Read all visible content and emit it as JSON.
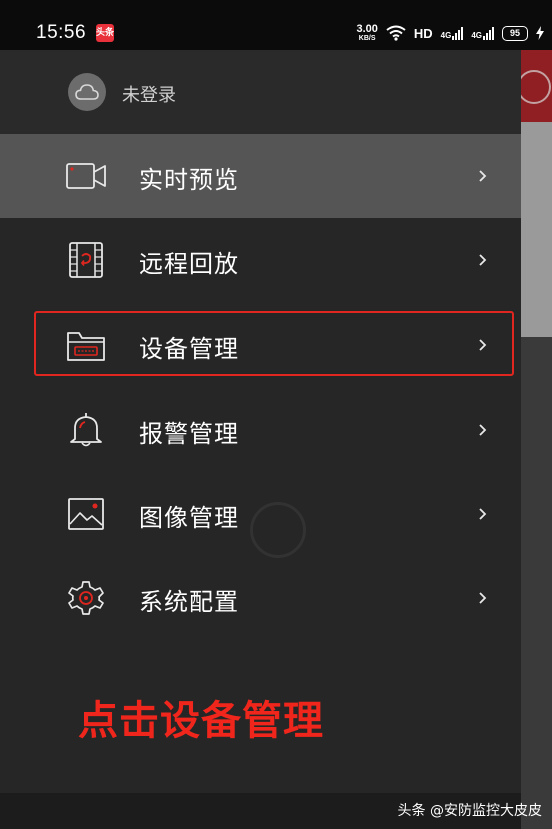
{
  "status_bar": {
    "time": "15:56",
    "app_badge": "头条",
    "net_speed_value": "3.00",
    "net_speed_unit": "KB/S",
    "hd_label": "HD",
    "network_label_1": "4G",
    "network_label_2": "4G",
    "battery": "95"
  },
  "account": {
    "label": "未登录",
    "icon": "cloud-icon"
  },
  "menu": {
    "items": [
      {
        "label": "实时预览",
        "icon": "video-camera-icon"
      },
      {
        "label": "远程回放",
        "icon": "playback-film-icon"
      },
      {
        "label": "设备管理",
        "icon": "device-folder-icon"
      },
      {
        "label": "报警管理",
        "icon": "bell-icon"
      },
      {
        "label": "图像管理",
        "icon": "image-icon"
      },
      {
        "label": "系统配置",
        "icon": "gear-icon"
      }
    ]
  },
  "annotation": "点击设备管理",
  "watermark": "头条 @安防监控大皮皮",
  "colors": {
    "accent_red": "#e0261f",
    "active_row": "#555555",
    "drawer_bg": "#262626"
  }
}
